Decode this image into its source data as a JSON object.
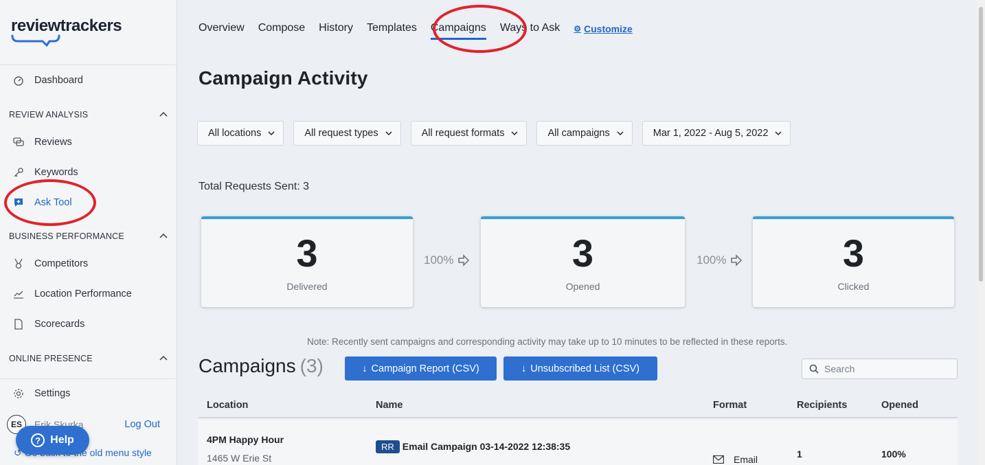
{
  "sidebar": {
    "logo": "reviewtrackers",
    "dashboard": "Dashboard",
    "sections": {
      "review_analysis": "REVIEW ANALYSIS",
      "business_performance": "BUSINESS PERFORMANCE",
      "online_presence": "ONLINE PRESENCE"
    },
    "items": {
      "reviews": "Reviews",
      "keywords": "Keywords",
      "ask_tool": "Ask Tool",
      "competitors": "Competitors",
      "location_performance": "Location Performance",
      "scorecards": "Scorecards",
      "settings": "Settings"
    },
    "user": {
      "initials": "ES",
      "name": "Erik Skurka",
      "logout": "Log Out"
    },
    "old_menu": "Go back to the old menu style",
    "help": "Help"
  },
  "tabs": [
    "Overview",
    "Compose",
    "History",
    "Templates",
    "Campaigns",
    "Ways to Ask"
  ],
  "active_tab": "Campaigns",
  "customize": "Customize",
  "page_title": "Campaign Activity",
  "filters": {
    "locations": "All locations",
    "request_types": "All request types",
    "request_formats": "All request formats",
    "campaigns": "All campaigns",
    "date_range": "Mar 1, 2022 - Aug 5, 2022"
  },
  "total_requests": "Total Requests Sent: 3",
  "funnel": {
    "delivered": {
      "value": "3",
      "label": "Delivered"
    },
    "opened": {
      "value": "3",
      "label": "Opened"
    },
    "clicked": {
      "value": "3",
      "label": "Clicked"
    },
    "rate_1": "100%",
    "rate_2": "100%"
  },
  "note": "Note: Recently sent campaigns and corresponding activity may take up to 10 minutes to be reflected in these reports.",
  "campaigns": {
    "title": "Campaigns",
    "count": "(3)",
    "report_btn": "Campaign Report (CSV)",
    "unsub_btn": "Unsubscribed List (CSV)",
    "search_placeholder": "Search"
  },
  "table": {
    "headers": {
      "location": "Location",
      "name": "Name",
      "format": "Format",
      "recipients": "Recipients",
      "opened": "Opened"
    },
    "rows": [
      {
        "location": "4PM Happy Hour",
        "address": "1465 W Erie St",
        "badge": "RR",
        "name": "Email Campaign 03-14-2022 12:38:35",
        "format": "Email",
        "recipients": "1",
        "opened": "100%"
      }
    ]
  },
  "colors": {
    "accent": "#2266c8",
    "button": "#2e6fd0",
    "card_top": "#3a9dd6",
    "annotation": "#e0232b"
  }
}
